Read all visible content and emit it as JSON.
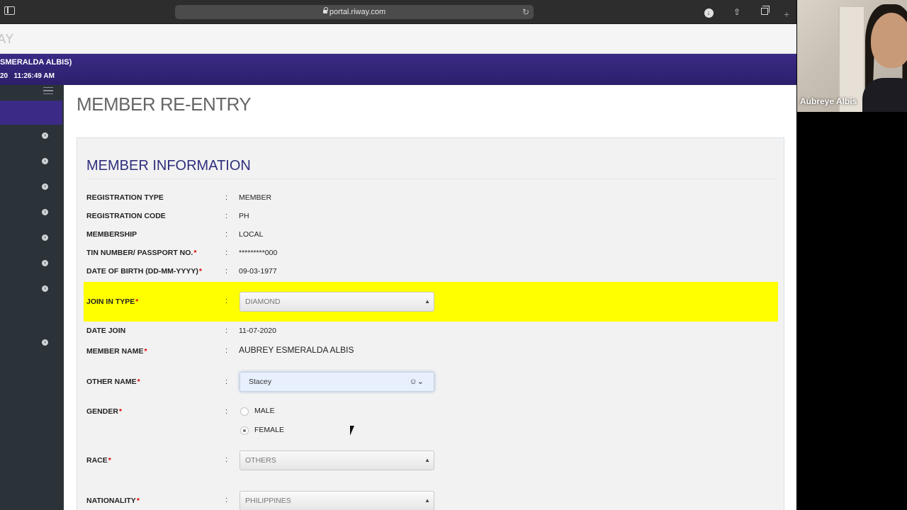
{
  "browser": {
    "url": "portal.riway.com"
  },
  "site": {
    "logo_text": "AY",
    "user_line1": "SMERALDA ALBIS)",
    "user_line2": "20   11:26:49 AM"
  },
  "page": {
    "title": "MEMBER RE-ENTRY",
    "section_title": "MEMBER INFORMATION"
  },
  "form": {
    "registration_type": {
      "label": "REGISTRATION TYPE",
      "value": "MEMBER"
    },
    "registration_code": {
      "label": "REGISTRATION CODE",
      "value": "PH"
    },
    "membership": {
      "label": "MEMBERSHIP",
      "value": "LOCAL"
    },
    "tin_number": {
      "label": "TIN NUMBER/ PASSPORT NO.",
      "value": "*********000"
    },
    "dob": {
      "label": "DATE OF BIRTH (DD-MM-YYYY)",
      "value": "09-03-1977"
    },
    "join_in_type": {
      "label": "JOIN IN TYPE",
      "value": "DIAMOND"
    },
    "date_join": {
      "label": "DATE JOIN",
      "value": "11-07-2020"
    },
    "member_name": {
      "label": "MEMBER NAME",
      "value": "AUBREY ESMERALDA ALBIS"
    },
    "other_name": {
      "label": "OTHER NAME",
      "value": "Stacey"
    },
    "gender": {
      "label": "GENDER",
      "options": [
        "MALE",
        "FEMALE"
      ],
      "selected": "FEMALE"
    },
    "race": {
      "label": "RACE",
      "value": "OTHERS"
    },
    "nationality": {
      "label": "NATIONALITY",
      "value": "PHILIPPINES"
    },
    "colon": ":",
    "required_mark": "*"
  },
  "video": {
    "participant_name": "Aubreye Albis"
  },
  "colors": {
    "brand_purple": "#2c1f6b",
    "highlight": "#ffff00",
    "sidebar": "#2c3338"
  }
}
